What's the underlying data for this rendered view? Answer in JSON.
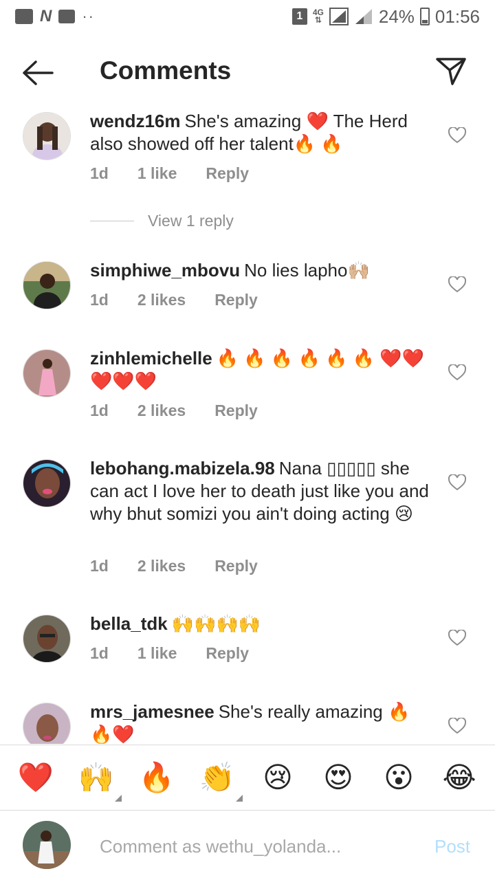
{
  "status_bar": {
    "sim_badge": "1",
    "network": "4G",
    "battery": "24%",
    "time": "01:56",
    "left_dots": "··"
  },
  "header": {
    "title": "Comments",
    "back_icon": "arrow-left-icon",
    "send_icon": "paper-plane-icon"
  },
  "comments": [
    {
      "username": "wendz16m",
      "text": "She's amazing ❤️ The Herd also showed off her talent🔥 🔥",
      "age": "1d",
      "likes": "1 like",
      "reply": "Reply",
      "view_replies": "View 1 reply"
    },
    {
      "username": "simphiwe_mbovu",
      "text": "No lies lapho🙌🏼",
      "age": "1d",
      "likes": "2 likes",
      "reply": "Reply"
    },
    {
      "username": "zinhlemichelle",
      "text": "🔥 🔥 🔥 🔥 🔥 🔥 ❤️❤️❤️❤️❤️",
      "age": "1d",
      "likes": "2 likes",
      "reply": "Reply"
    },
    {
      "username": "lebohang.mabizela.98",
      "text": "Nana ▯▯▯▯▯ she can act I love her to death just like you and why bhut somizi you ain't doing acting 😢",
      "age": "1d",
      "likes": "2 likes",
      "reply": "Reply"
    },
    {
      "username": "bella_tdk",
      "text": "🙌🙌🙌🙌",
      "age": "1d",
      "likes": "1 like",
      "reply": "Reply"
    },
    {
      "username": "mrs_jamesnee",
      "text": "She's really amazing 🔥 🔥❤️",
      "age": "",
      "likes": "",
      "reply": ""
    }
  ],
  "emoji_bar": [
    "❤️",
    "🙌",
    "🔥",
    "👏",
    "😢",
    "😍",
    "😮",
    "😂"
  ],
  "composer": {
    "placeholder": "Comment as wethu_yolanda...",
    "post_label": "Post"
  },
  "colors": {
    "text": "#262626",
    "secondary": "#8e8e8e",
    "post_disabled": "#b2dffc"
  }
}
